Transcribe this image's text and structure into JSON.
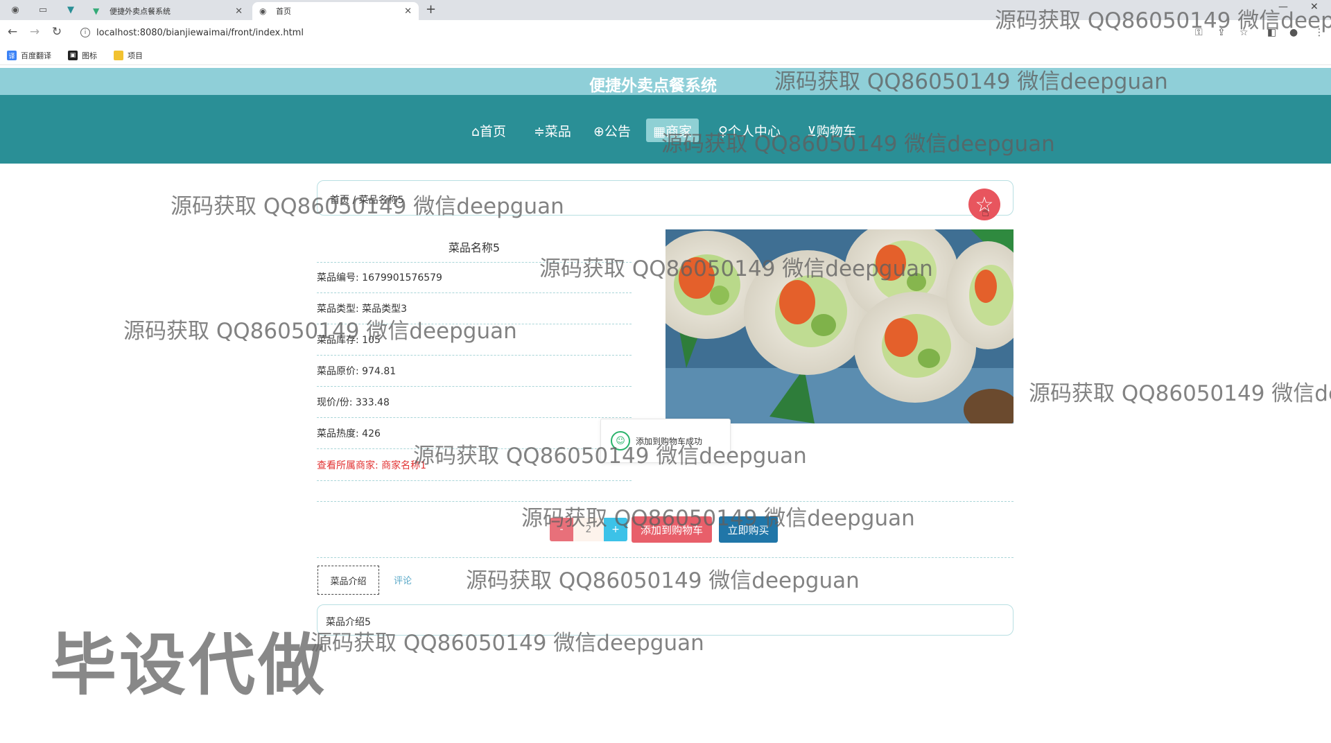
{
  "browser": {
    "tabs": [
      {
        "title": "便捷外卖点餐系统",
        "active": false
      },
      {
        "title": "首页",
        "active": true
      }
    ],
    "url": "localhost:8080/bianjiewaimai/front/index.html",
    "bookmarks": [
      "百度翻译",
      "图标",
      "项目"
    ]
  },
  "site": {
    "title": "便捷外卖点餐系统",
    "nav": [
      {
        "label": "⌂首页",
        "active": false
      },
      {
        "label": "≑菜品",
        "active": false
      },
      {
        "label": "⊕公告",
        "active": false
      },
      {
        "label": "▦商家",
        "active": true
      },
      {
        "label": "♀个人中心",
        "active": false
      },
      {
        "label": "⊻购物车",
        "active": false
      }
    ]
  },
  "breadcrumb": "首页 / 菜品名称5",
  "dish": {
    "name": "菜品名称5",
    "rows": [
      "菜品编号: 1679901576579",
      "菜品类型: 菜品类型3",
      "菜品库存: 105",
      "菜品原价: 974.81",
      "现价/份: 333.48",
      "菜品热度: 426"
    ],
    "merchant_link": "查看所属商家: 商家名称1",
    "quantity": "2",
    "minus_label": "-",
    "plus_label": "+",
    "add_cart_label": "添加到购物车",
    "buy_label": "立即购买"
  },
  "toast": "添加到购物车成功",
  "detail_tabs": {
    "intro": "菜品介绍",
    "review": "评论"
  },
  "description": "菜品介绍5",
  "watermarks": {
    "text": "源码获取 QQ86050149 微信deepguan",
    "big": "毕设代做"
  },
  "colors": {
    "header_light": "#8fcfd8",
    "nav_bg": "#2a8f96",
    "accent_red": "#e8555e",
    "buy_blue": "#2076a8",
    "plus_blue": "#3cc2e8",
    "link_red": "#e23333"
  }
}
